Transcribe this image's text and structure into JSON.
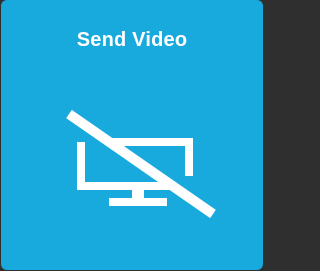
{
  "tile": {
    "title": "Send Video",
    "icon": "video-off-monitor-icon",
    "state": "off"
  },
  "colors": {
    "tile_background": "#18aadd",
    "foreground": "#ffffff",
    "page_background": "#2f2f2f"
  }
}
